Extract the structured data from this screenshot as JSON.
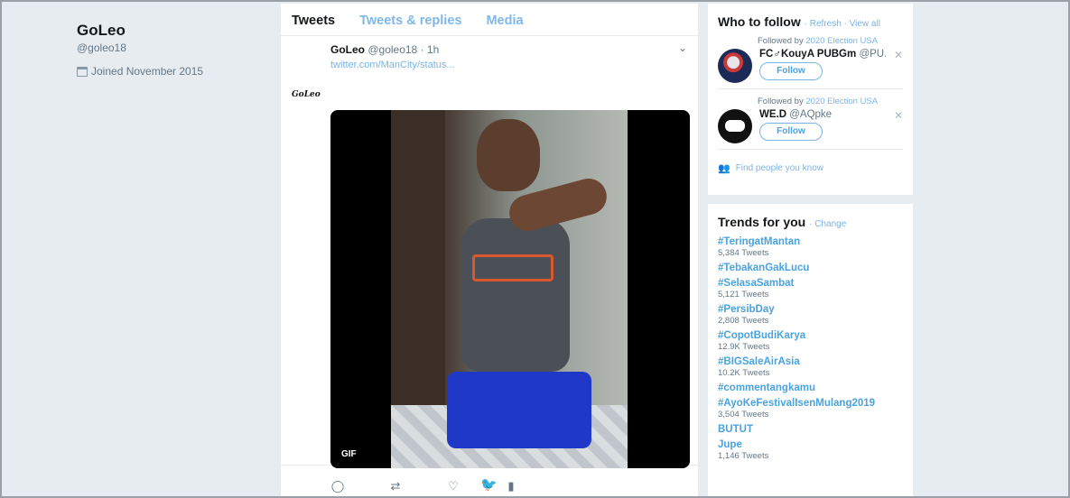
{
  "profile": {
    "name": "GoLeo",
    "handle": "@goleo18",
    "joined": "Joined November 2015"
  },
  "timeline": {
    "tabs": [
      "Tweets",
      "Tweets & replies",
      "Media"
    ],
    "tweet": {
      "avatar_text": "GoLeo",
      "name": "GoLeo",
      "meta": "@goleo18 · 1h",
      "link": "twitter.com/ManCity/status...",
      "media_badge": "GIF",
      "actions": [
        "reply-icon",
        "retweet-icon",
        "like-icon",
        "analytics-icon"
      ]
    }
  },
  "who_to_follow": {
    "title": "Who to follow",
    "refresh": "Refresh",
    "view_all": "View all",
    "separator": " · ",
    "items": [
      {
        "followed_prefix": "Followed by ",
        "followed_by": "2020 Election USA",
        "name": "FC♂KouyA PUBGm",
        "handle": "@PU...",
        "button": "Follow"
      },
      {
        "followed_prefix": "Followed by ",
        "followed_by": "2020 Election USA",
        "name": "WE.D",
        "handle": "@AQpke",
        "button": "Follow"
      }
    ],
    "find_people": "Find people you know"
  },
  "trends": {
    "title": "Trends for you",
    "change": "Change",
    "items": [
      {
        "tag": "#TeringatMantan",
        "count": "5,384 Tweets"
      },
      {
        "tag": "#TebakanGakLucu",
        "count": ""
      },
      {
        "tag": "#SelasaSambat",
        "count": "5,121 Tweets"
      },
      {
        "tag": "#PersibDay",
        "count": "2,808 Tweets"
      },
      {
        "tag": "#CopotBudiKarya",
        "count": "12.9K Tweets"
      },
      {
        "tag": "#BIGSaleAirAsia",
        "count": "10.2K Tweets"
      },
      {
        "tag": "#commentangkamu",
        "count": ""
      },
      {
        "tag": "#AyoKeFestivalIsenMulang2019",
        "count": "3,504 Tweets"
      },
      {
        "tag": "BUTUT",
        "count": ""
      },
      {
        "tag": "Jupe",
        "count": "1,146 Tweets"
      }
    ]
  },
  "colors": {
    "background": "#e6ecf0",
    "link": "#4aa3df",
    "muted": "#657786"
  }
}
